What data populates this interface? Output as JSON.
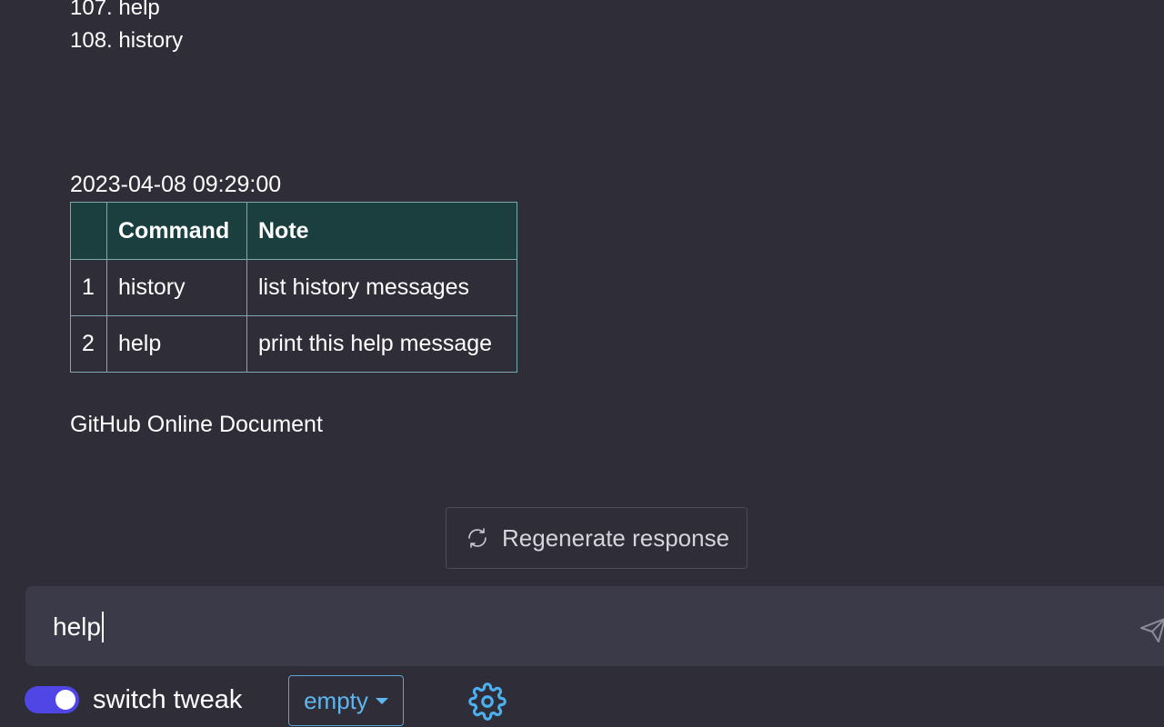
{
  "history": {
    "lines": [
      "107. help",
      "108. history"
    ]
  },
  "reply": {
    "timestamp": "2023-04-08 09:29:00",
    "table": {
      "headers": [
        "",
        "Command",
        "Note"
      ],
      "rows": [
        [
          "1",
          "history",
          "list history messages"
        ],
        [
          "2",
          "help",
          "print this help message"
        ]
      ]
    },
    "doc_link": "GitHub Online Document"
  },
  "regenerate": {
    "label": "Regenerate response",
    "icon": "refresh-icon"
  },
  "input": {
    "value": "help",
    "send_icon": "send-icon"
  },
  "controls": {
    "toggle_on": true,
    "toggle_label": "switch tweak",
    "select_value": "empty",
    "settings_icon": "gear-icon"
  },
  "colors": {
    "background": "#2f2e38",
    "input_background": "#3b3a48",
    "table_header": "#1b3e3f",
    "table_border": "#7ea8ad",
    "accent_blue": "#5fb6ee",
    "toggle_on": "#4f46e5"
  }
}
